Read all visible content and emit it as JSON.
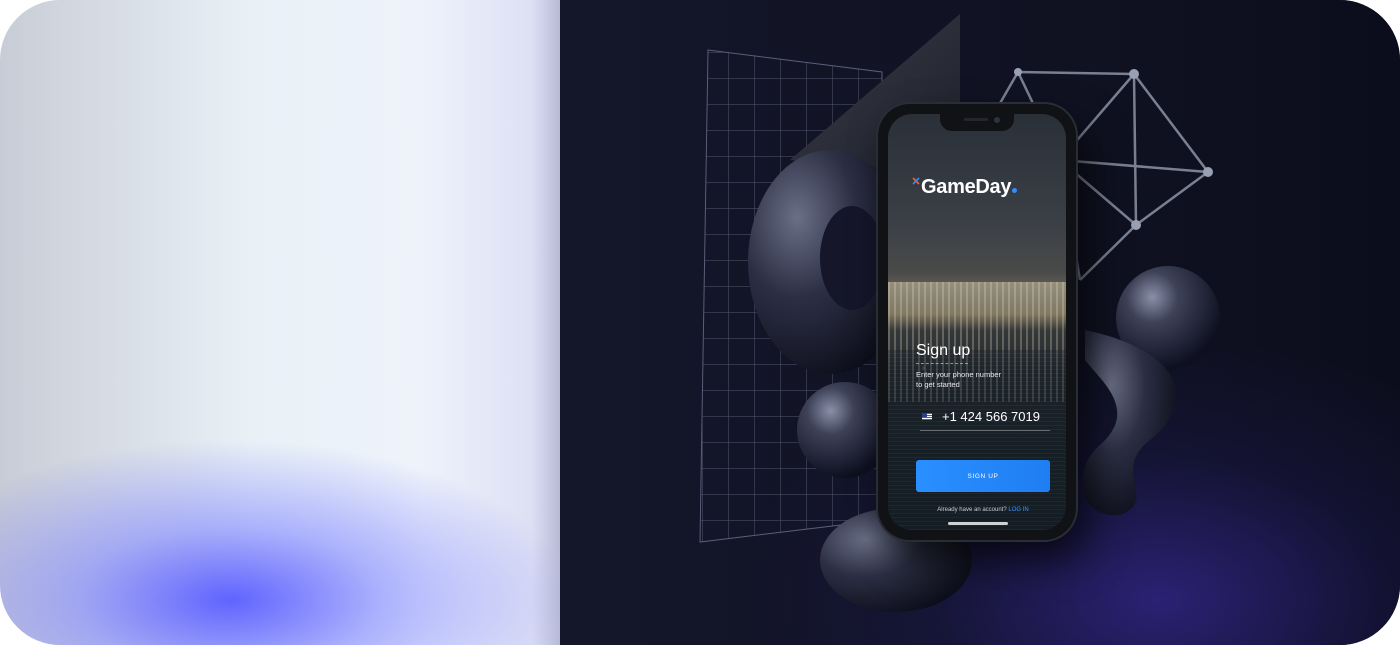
{
  "app": {
    "logo_text": "GameDay",
    "brand_color": "#2e8fff"
  },
  "signup": {
    "title": "Sign up",
    "subtitle_line1": "Enter your phone number",
    "subtitle_line2": "to get started",
    "country_flag": "us-flag-icon",
    "phone_value": "+1 424 566 7019",
    "button_label": "SIGN UP",
    "footer_text": "Already have an account?",
    "login_link": "LOG IN"
  },
  "colors": {
    "accent": "#2a8fff",
    "background_dark": "#13142a",
    "glow": "#585cff"
  }
}
